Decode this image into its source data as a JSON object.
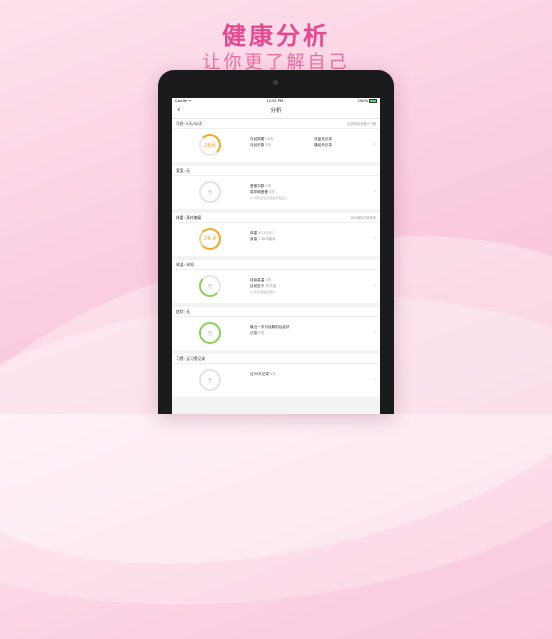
{
  "promo": {
    "headline": "健康分析",
    "subline": "让你更了解自己"
  },
  "status_bar": {
    "carrier": "Carrier ᯤ",
    "time": "12:52 PM",
    "battery": "100%"
  },
  "nav": {
    "back_icon": "chevron-left-icon",
    "title": "分析"
  },
  "sections": [
    {
      "title": "月经: 5天/30天",
      "note": "后来修改总都比了解",
      "ring_text": "28天",
      "ring_style": "orange",
      "left": [
        {
          "k": "月经周期",
          "v": "28天"
        },
        {
          "k": "月经天数",
          "v": "5天"
        }
      ],
      "right": [
        {
          "k": "流量",
          "v": "未记录"
        },
        {
          "k": "痛经",
          "v": "未记录"
        }
      ],
      "tip": ""
    },
    {
      "title": "爱爱: 无",
      "note": "",
      "ring_text": "无",
      "ring_style": "grey",
      "left": [
        {
          "k": "爱爱次数",
          "v": "0次"
        },
        {
          "k": "易孕期爱爱",
          "v": "0次"
        }
      ],
      "right": [],
      "tip": "(i) 你有爱爱记录后才会显示"
    },
    {
      "title": "体重: 身材偏瘦",
      "note": "BMI指标方便参考",
      "ring_text": "24.4",
      "ring_style": "orange-full",
      "left": [
        {
          "k": "体重",
          "v": "47.0公斤"
        },
        {
          "k": "身高",
          "v": "138.8厘米"
        }
      ],
      "right": [],
      "tip": ""
    },
    {
      "title": "体温: 未知",
      "note": "",
      "ring_text": "无",
      "ring_style": "green-part",
      "left": [
        {
          "k": "持续高温",
          "v": "0天"
        },
        {
          "k": "目前处于",
          "v": "未升温"
        }
      ],
      "right": [],
      "tip": "(i) 暂不能得出结论"
    },
    {
      "title": "症状: 无",
      "note": "",
      "ring_text": "无",
      "ring_style": "green",
      "left": [
        {
          "k": "最近一次与经期前后症状",
          "v": ""
        },
        {
          "k": "记录",
          "v": "0项"
        }
      ],
      "right": [],
      "tip": ""
    },
    {
      "title": "习惯: 无习惯记录",
      "note": "",
      "ring_text": "无",
      "ring_style": "grey",
      "left": [
        {
          "k": "近30天记录",
          "v": "0天"
        }
      ],
      "right": [],
      "tip": ""
    }
  ],
  "colors": {
    "accent": "#e8488f",
    "ring_orange": "#f5a623",
    "ring_green": "#8cd058"
  }
}
